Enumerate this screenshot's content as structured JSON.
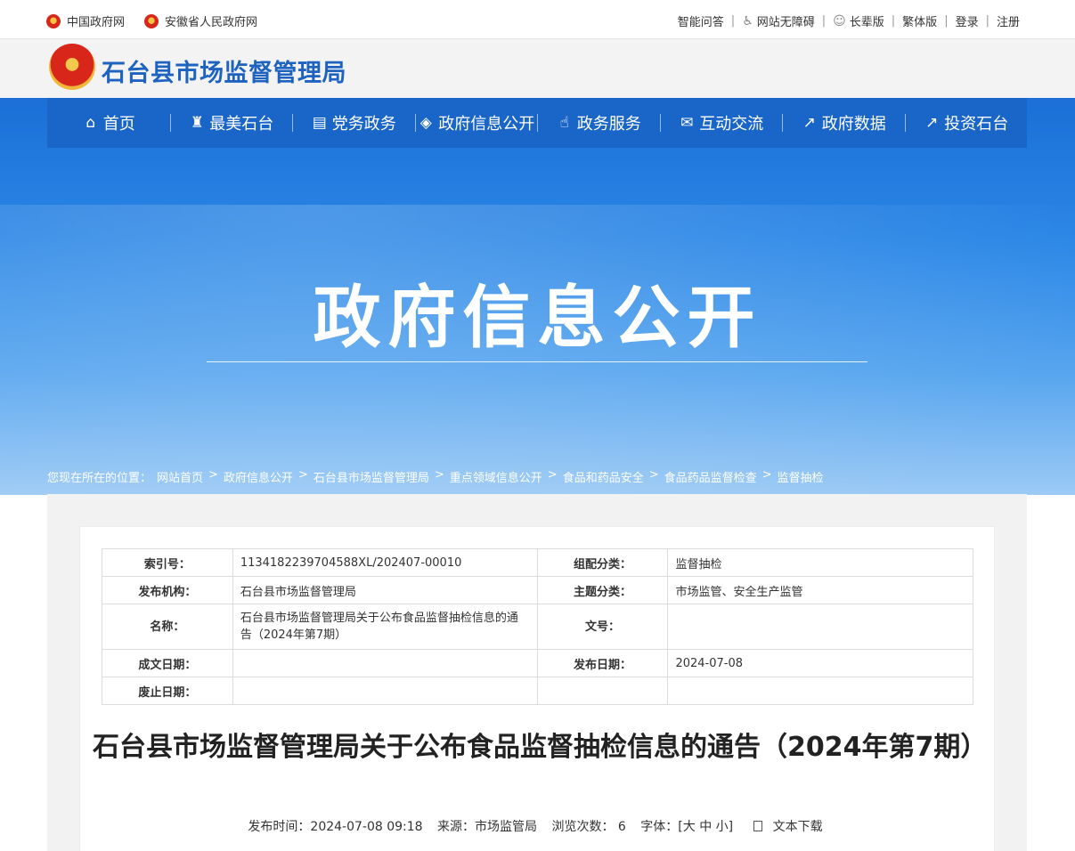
{
  "topbar": {
    "links_left": [
      {
        "label": "中国政府网",
        "icon": "emblem-icon"
      },
      {
        "label": "安徽省人民政府网",
        "icon": "emblem-icon"
      }
    ],
    "links_right": [
      {
        "label": "智能问答"
      },
      {
        "label": "网站无障碍",
        "icon": "wheelchair-icon"
      },
      {
        "label": "长辈版",
        "icon": "elder-icon"
      },
      {
        "label": "繁体版"
      },
      {
        "label": "登录"
      },
      {
        "label": "注册"
      }
    ]
  },
  "header": {
    "title": "石台县市场监督管理局",
    "logo": "national-emblem"
  },
  "nav": [
    {
      "label": "首页",
      "icon": "home-icon",
      "glyph": "⌂"
    },
    {
      "label": "最美石台",
      "icon": "pagoda-icon",
      "glyph": "♜"
    },
    {
      "label": "党务政务",
      "icon": "document-icon",
      "glyph": "▤"
    },
    {
      "label": "政府信息公开",
      "icon": "layers-icon",
      "glyph": "◈"
    },
    {
      "label": "政务服务",
      "icon": "hand-icon",
      "glyph": "☝"
    },
    {
      "label": "互动交流",
      "icon": "chat-icon",
      "glyph": "✉"
    },
    {
      "label": "政府数据",
      "icon": "chart-icon",
      "glyph": "↗"
    },
    {
      "label": "投资石台",
      "icon": "trend-icon",
      "glyph": "↗"
    }
  ],
  "banner": {
    "title": "政府信息公开"
  },
  "breadcrumb": {
    "prefix": "您现在所在的位置：",
    "items": [
      "网站首页",
      "政府信息公开",
      "石台县市场监督管理局",
      "重点领域信息公开",
      "食品和药品安全",
      "食品药品监督检查",
      "监督抽检"
    ],
    "separator": ">"
  },
  "meta": {
    "index_label": "索引号：",
    "index_value": "1134182239704588XL/202407-00010",
    "category_label": "组配分类：",
    "category_value": "监督抽检",
    "org_label": "发布机构：",
    "org_value": "石台县市场监督管理局",
    "topic_label": "主题分类：",
    "topic_value": "市场监管、安全生产监管",
    "name_label": "名称：",
    "name_value": "石台县市场监督管理局关于公布食品监督抽检信息的通告（2024年第7期）",
    "docno_label": "文号：",
    "docno_value": "",
    "created_label": "成文日期：",
    "created_value": "",
    "published_label": "发布日期：",
    "published_value": "2024-07-08",
    "expiry_label": "废止日期：",
    "expiry_value": ""
  },
  "article": {
    "title": "石台县市场监督管理局关于公布食品监督抽检信息的通告（2024年第7期）",
    "publish_time": "发布时间：2024-07-08 09:18",
    "source": "来源：市场监管局",
    "views": "浏览次数： 6",
    "font_size": "字体：[大 中 小]",
    "download": "文本下载"
  },
  "colors": {
    "nav_bg": "#1a66c8",
    "header_title": "#1f63c0",
    "banner_top": "#1b6fd6"
  }
}
